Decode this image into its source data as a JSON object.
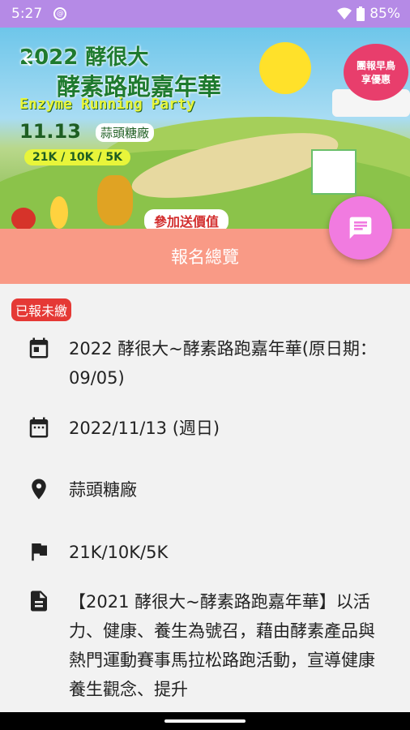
{
  "status_bar": {
    "time": "5:27",
    "battery": "85%"
  },
  "banner": {
    "title_line1": "2022 酵很大",
    "title_line2": "酵素路跑嘉年華",
    "title_en": "Enzyme Running Party",
    "date": "11.13",
    "place": "蒜頭糖廠",
    "distances": "21K / 10K / 5K",
    "promo_line1": "團報早鳥",
    "promo_line2": "享優惠",
    "gift": "參加送價值"
  },
  "toolbar": {
    "title": "報名總覽"
  },
  "badge": "已報未繳",
  "details": {
    "event_name": "2022 酵很大~酵素路跑嘉年華(原日期：09/05)",
    "event_date": "2022/11/13 (週日)",
    "location": "蒜頭糖廠",
    "distances": "21K/10K/5K",
    "description": "【2021 酵很大~酵素路跑嘉年華】以活力、健康、養生為號召，藉由酵素產品與熱門運動賽事馬拉松路跑活動，宣導健康養生觀念、提升"
  },
  "icons": {
    "calendar": "calendar-icon",
    "date": "calendar-date-icon",
    "location": "location-pin-icon",
    "flag": "flag-icon",
    "document": "document-icon",
    "chat": "chat-icon",
    "back": "arrow-back-icon"
  },
  "colors": {
    "status_bar": "#b58ae6",
    "toolbar": "#f99a86",
    "fab": "#f17be0",
    "badge": "#e53935"
  }
}
